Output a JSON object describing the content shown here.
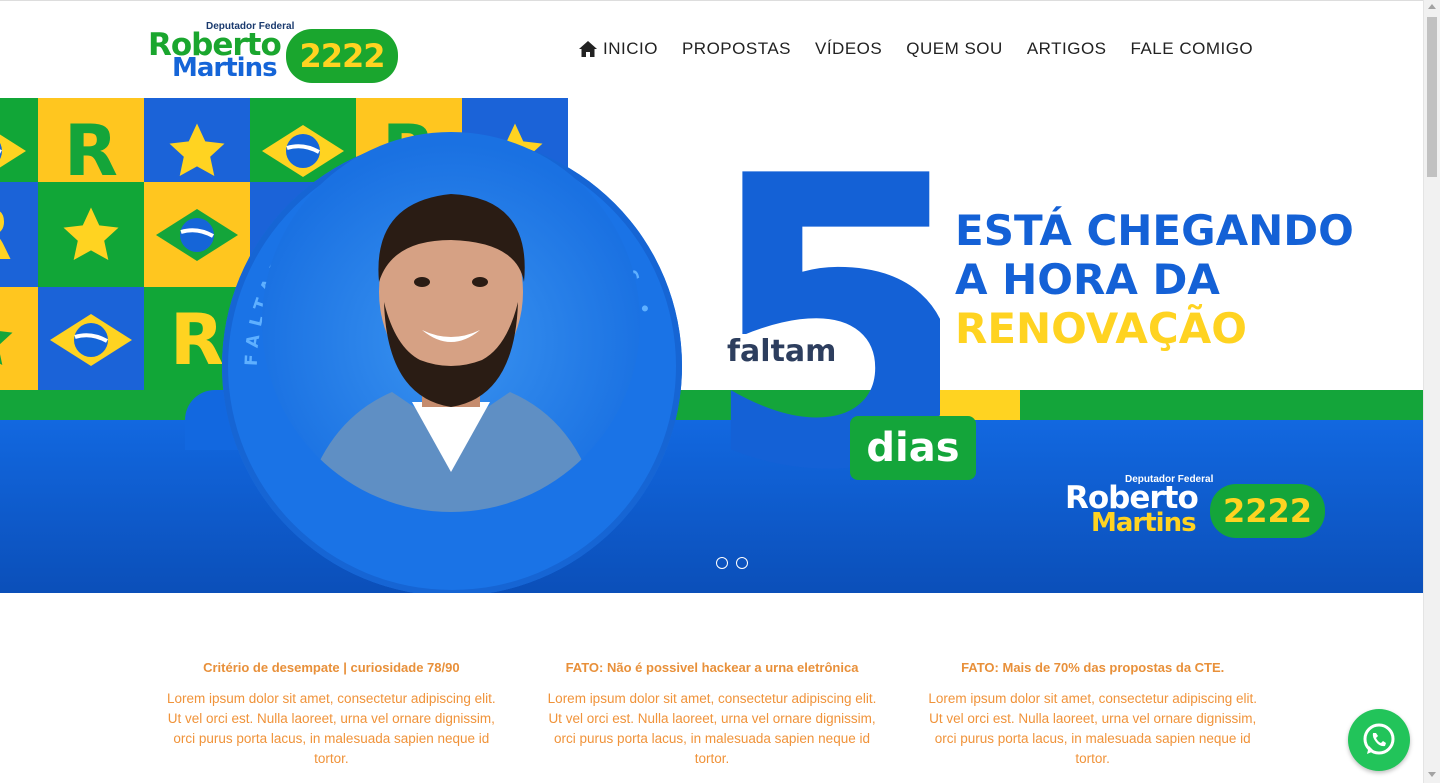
{
  "header": {
    "logo": {
      "subtitle": "Deputador Federal",
      "name_first": "Roberto",
      "name_last": "Martins",
      "number": "2222"
    },
    "nav": [
      {
        "label": "INICIO",
        "icon": "home-icon"
      },
      {
        "label": "PROPOSTAS"
      },
      {
        "label": "VÍDEOS"
      },
      {
        "label": "QUEM SOU"
      },
      {
        "label": "ARTIGOS"
      },
      {
        "label": "FALE COMIGO"
      }
    ]
  },
  "hero": {
    "ring_text": "FALTAM 5 DIAS • FALTAM 5 DIAS •",
    "big_number": "5",
    "faltam": "faltam",
    "dias": "dias",
    "headline_1": "ESTÁ CHEGANDO",
    "headline_2": "A HORA DA",
    "headline_3": "RENOVAÇÃO",
    "logo": {
      "subtitle": "Deputador Federal",
      "name_first": "Roberto",
      "name_last": "Martins",
      "number": "2222"
    },
    "carousel": {
      "slides": 2
    }
  },
  "articles": [
    {
      "title": "Critério de desempate | curiosidade 78/90",
      "body": "Lorem ipsum dolor sit amet, consectetur adipiscing elit. Ut vel orci est. Nulla laoreet, urna vel ornare dignissim, orci purus porta lacus, in malesuada sapien neque id tortor."
    },
    {
      "title": "FATO: Não é possivel hackear a urna eletrônica",
      "body": "Lorem ipsum dolor sit amet, consectetur adipiscing elit. Ut vel orci est. Nulla laoreet, urna vel ornare dignissim, orci purus porta lacus, in malesuada sapien neque id tortor."
    },
    {
      "title": "FATO: Mais de 70% das propostas da CTE.",
      "body": "Lorem ipsum dolor sit amet, consectetur adipiscing elit. Ut vel orci est. Nulla laoreet, urna vel ornare dignissim, orci purus porta lacus, in malesuada sapien neque id tortor."
    }
  ],
  "colors": {
    "green": "#14a53a",
    "blue": "#1461d6",
    "yellow": "#ffd321",
    "article_text": "#f0933a"
  },
  "floating": {
    "icon": "whatsapp-icon"
  }
}
